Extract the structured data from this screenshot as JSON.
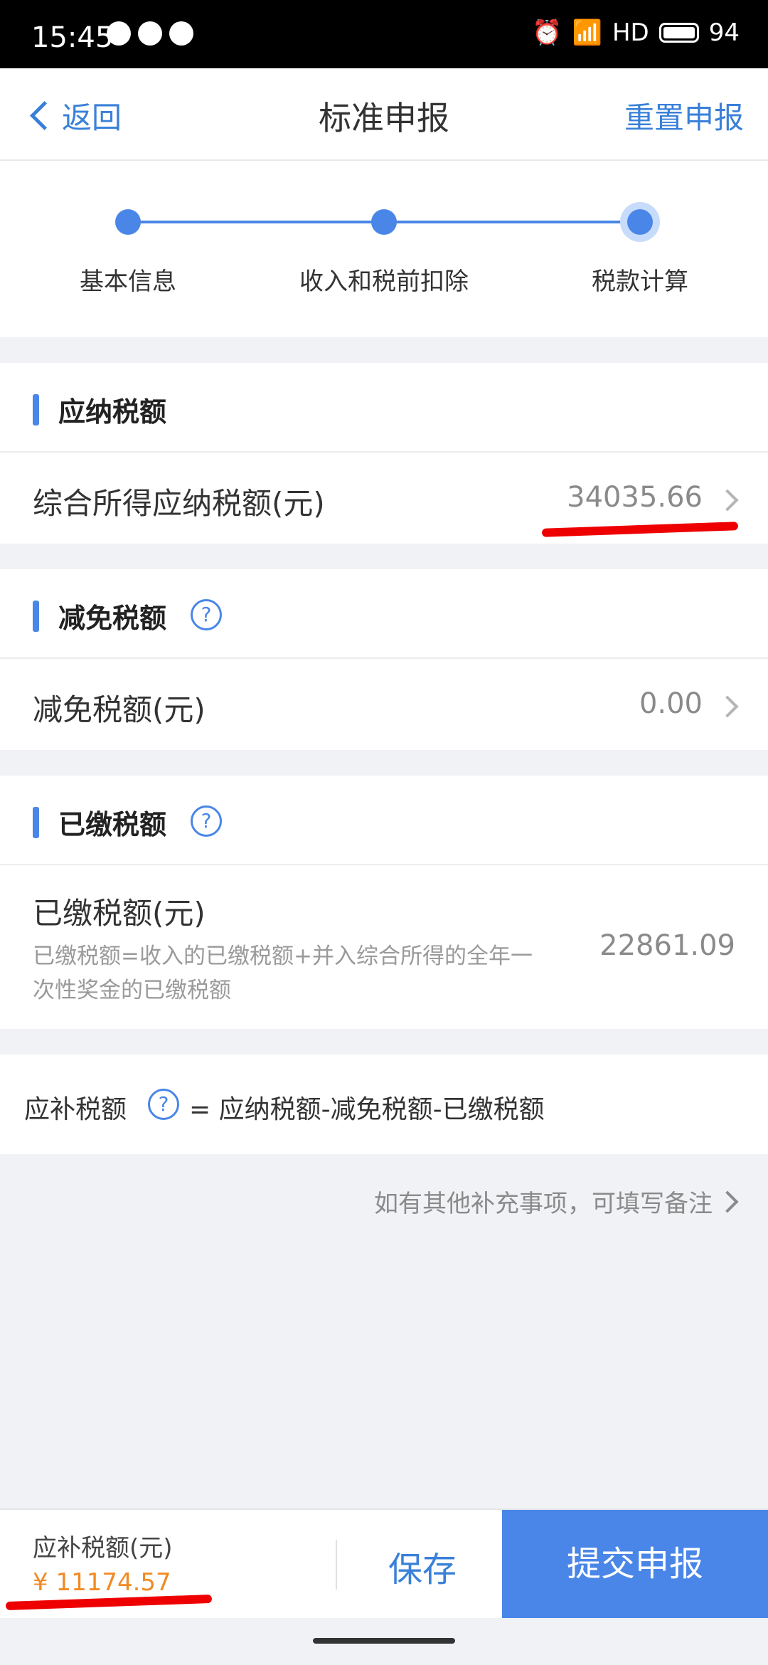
{
  "status_bar": {
    "time": "15:45",
    "network_label": "HD",
    "battery": "94"
  },
  "nav": {
    "back_label": "返回",
    "title": "标准申报",
    "reset_label": "重置申报"
  },
  "steps": [
    {
      "label": "基本信息"
    },
    {
      "label": "收入和税前扣除"
    },
    {
      "label": "税款计算"
    }
  ],
  "tax_payable": {
    "section_title": "应纳税额",
    "row_label": "综合所得应纳税额(元)",
    "row_value": "34035.66"
  },
  "tax_reduction": {
    "section_title": "减免税额",
    "row_label": "减免税额(元)",
    "row_value": "0.00"
  },
  "tax_paid": {
    "section_title": "已缴税额",
    "row_label": "已缴税额(元)",
    "row_desc_line1": "已缴税额=收入的已缴税额+并入综合所得的全年一",
    "row_desc_line2": "次性奖金的已缴税额",
    "row_value": "22861.09"
  },
  "formula": {
    "label": "应补税额",
    "expression": "= 应纳税额-减免税额-已缴税额"
  },
  "note": {
    "text": "如有其他补充事项，可填写备注"
  },
  "bottom_bar": {
    "amount_label": "应补税额(元)",
    "amount_value": "¥ 11174.57",
    "save_label": "保存",
    "submit_label": "提交申报"
  },
  "colors": {
    "accent": "#4a86e8",
    "link": "#3a80d9",
    "amount": "#f08a24",
    "annotation": "#ee0000"
  }
}
